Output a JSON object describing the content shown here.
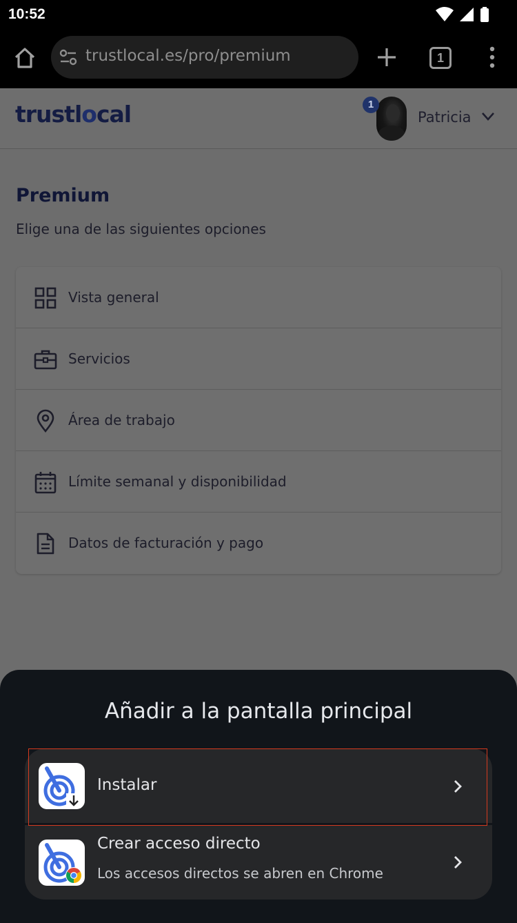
{
  "status_bar": {
    "time": "10:52"
  },
  "browser": {
    "url": "trustlocal.es/pro/premium",
    "tab_count": "1"
  },
  "header": {
    "logo_prefix": "trustl",
    "logo_middle": "o",
    "logo_suffix": "cal",
    "notification_count": "1",
    "user_name": "Patricia"
  },
  "page": {
    "title": "Premium",
    "subtitle": "Elige una de las siguientes opciones",
    "menu": [
      {
        "label": "Vista general",
        "icon": "grid-icon"
      },
      {
        "label": "Servicios",
        "icon": "briefcase-icon"
      },
      {
        "label": "Área de trabajo",
        "icon": "location-pin-icon"
      },
      {
        "label": "Límite semanal y disponibilidad",
        "icon": "calendar-icon"
      },
      {
        "label": "Datos de facturación y pago",
        "icon": "document-icon"
      }
    ]
  },
  "sheet": {
    "title": "Añadir a la pantalla principal",
    "options": [
      {
        "label": "Instalar",
        "sublabel": ""
      },
      {
        "label": "Crear acceso directo",
        "sublabel": "Los accesos directos se abren en Chrome"
      }
    ]
  },
  "colors": {
    "sheet_background": "#11151a",
    "option_background": "#262729",
    "highlight_border": "#d63a1e",
    "logo_color": "#141c43",
    "app_icon_blue": "#3f6ee0"
  }
}
